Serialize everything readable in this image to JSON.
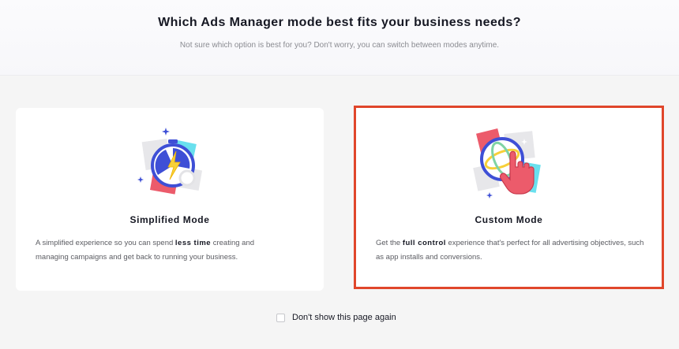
{
  "header": {
    "title": "Which Ads Manager mode best fits your business needs?",
    "subtitle": "Not sure which option is best for you? Don't worry, you can switch between modes anytime."
  },
  "modes": [
    {
      "title": "Simplified Mode",
      "desc_before": "A simplified experience so you can spend ",
      "desc_bold": "less time",
      "desc_after": " creating and managing campaigns and get back to running your business.",
      "icon": "stopwatch-lightning-icon",
      "selected": false
    },
    {
      "title": "Custom Mode",
      "desc_before": "Get the ",
      "desc_bold": "full control",
      "desc_after": " experience that's perfect for all advertising objectives, such as app installs and conversions.",
      "icon": "globe-pointer-hand-icon",
      "selected": true
    }
  ],
  "footer": {
    "dont_show_label": "Don't show this page again",
    "dont_show_checked": false
  },
  "colors": {
    "selection_outline": "#e0462b",
    "accent_pink": "#ec5b6b",
    "accent_blue": "#3e4fd6",
    "accent_cyan": "#69e0ee",
    "accent_yellow": "#f7d039"
  }
}
